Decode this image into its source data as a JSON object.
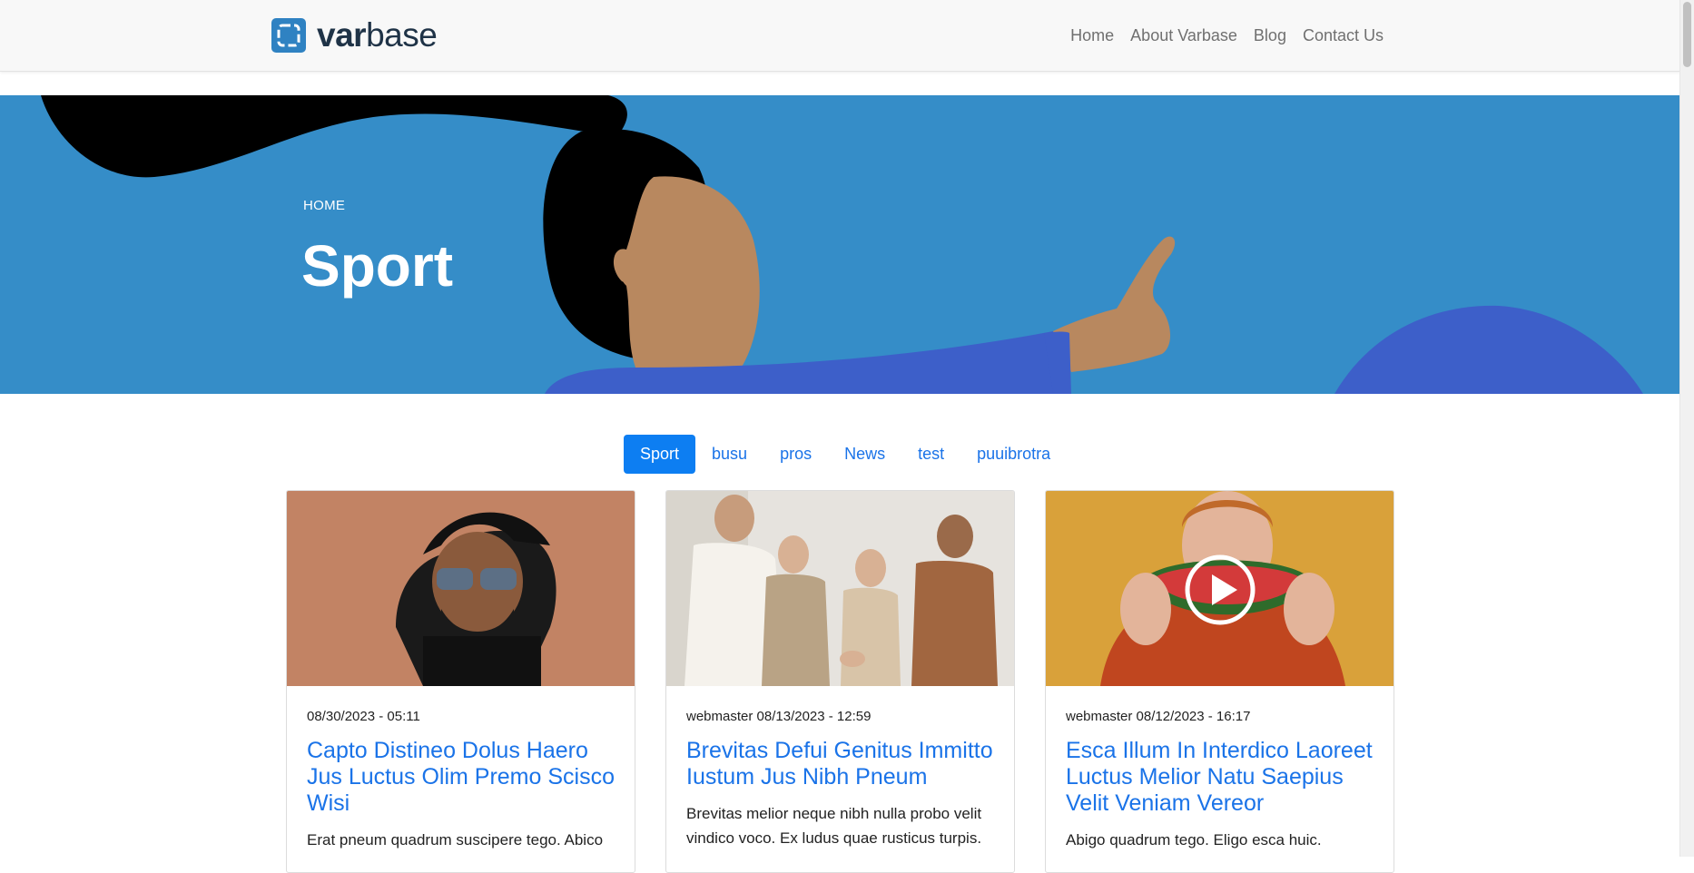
{
  "brand": {
    "name_part1": "var",
    "name_part2": "base"
  },
  "nav": {
    "items": [
      "Home",
      "About Varbase",
      "Blog",
      "Contact Us"
    ]
  },
  "hero": {
    "breadcrumb": "HOME",
    "title": "Sport"
  },
  "tabs": {
    "items": [
      "Sport",
      "busu",
      "pros",
      "News",
      "test",
      "puuibrotra"
    ],
    "active": "Sport"
  },
  "cards": [
    {
      "meta": "08/30/2023 - 05:11",
      "title": "Capto Distineo Dolus Haero Jus Luctus Olim Premo Scisco Wisi",
      "excerpt": "Erat pneum quadrum suscipere tego. Abico"
    },
    {
      "meta": "webmaster 08/13/2023 - 12:59",
      "title": "Brevitas Defui Genitus Immitto Iustum Jus Nibh Pneum",
      "excerpt": "Brevitas melior neque nibh nulla probo velit vindico voco. Ex ludus quae rusticus turpis."
    },
    {
      "meta": "webmaster 08/12/2023 - 16:17",
      "title": "Esca Illum In Interdico Laoreet Luctus Melior Natu Saepius Velit Veniam Vereor",
      "excerpt": "Abigo quadrum tego. Eligo esca huic."
    }
  ],
  "colors": {
    "hero_bg": "#358dc8",
    "link": "#1a73e8",
    "active_tab": "#0d7ef2",
    "logo": "#2f82c2"
  }
}
